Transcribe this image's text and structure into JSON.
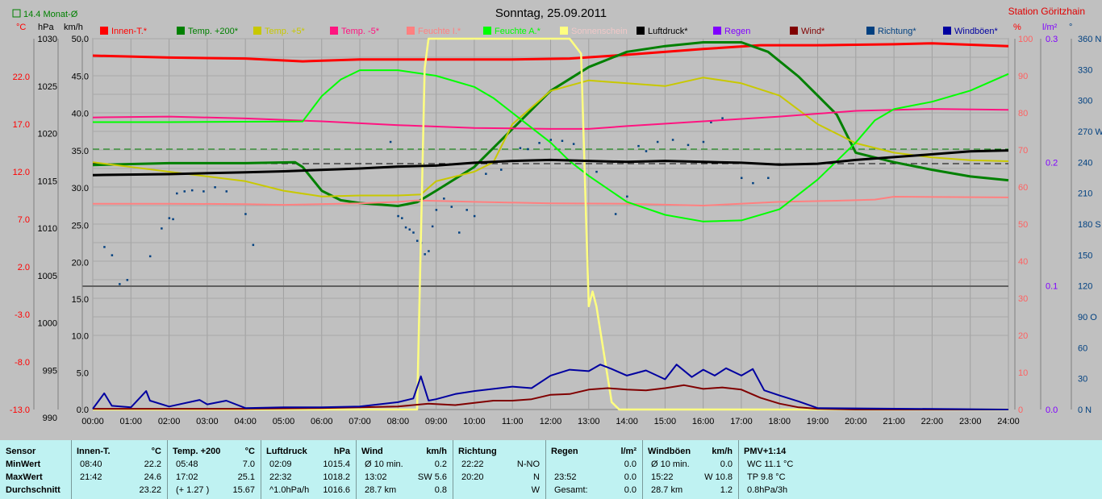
{
  "title": "Sonntag, 25.09.2011",
  "station": "Station Göritzhain",
  "monat_label": "14.4 Monat-Ø",
  "axis_units": {
    "celsius": "°C",
    "hpa": "hPa",
    "kmh": "km/h",
    "percent": "%",
    "lm2": "l/m²",
    "deg": "°"
  },
  "legend": [
    {
      "label": "Innen-T.*",
      "color": "#ff0000"
    },
    {
      "label": "Temp. +200*",
      "color": "#008000"
    },
    {
      "label": "Temp. +5*",
      "color": "#c8c800"
    },
    {
      "label": "Temp. -5*",
      "color": "#ff1480"
    },
    {
      "label": "Feuchte I.*",
      "color": "#ff8080"
    },
    {
      "label": "Feuchte A.*",
      "color": "#00ff00"
    },
    {
      "label": "Sonnenschein",
      "color": "#ffff80"
    },
    {
      "label": "Luftdruck*",
      "color": "#000000"
    },
    {
      "label": "Regen",
      "color": "#8000ff"
    },
    {
      "label": "Wind*",
      "color": "#800000"
    },
    {
      "label": "Richtung*",
      "color": "#004080"
    },
    {
      "label": "Windböen*",
      "color": "#0000a0"
    }
  ],
  "axes": {
    "celsius": [
      "22.0",
      "17.0",
      "12.0",
      "7.0",
      "2.0",
      "-3.0",
      "-8.0",
      "-13.0"
    ],
    "hpa": [
      "1030",
      "1025",
      "1020",
      "1015",
      "1010",
      "1005",
      "1000",
      "995",
      "990"
    ],
    "kmh_upper": [
      "50.0",
      "45.0",
      "40.0",
      "35.0",
      "30.0",
      "25.0",
      "20.0"
    ],
    "kmh_lower": [
      "15.0",
      "10.0",
      "5.0",
      "0.0"
    ],
    "percent_upper": [
      "100",
      "90",
      "80",
      "70",
      "60",
      "50",
      "40"
    ],
    "percent_lower": [
      "30",
      "20",
      "10",
      "0"
    ],
    "lm2": [
      "0.3",
      "0.2",
      "0.1",
      "0.0"
    ],
    "deg": [
      "360 N",
      "330",
      "300",
      "270 W",
      "240",
      "210",
      "180 S",
      "150",
      "120",
      "90 O",
      "60",
      "30",
      "0 N"
    ],
    "time": [
      "00:00",
      "01:00",
      "02:00",
      "03:00",
      "04:00",
      "05:00",
      "06:00",
      "07:00",
      "08:00",
      "09:00",
      "10:00",
      "11:00",
      "12:00",
      "13:00",
      "14:00",
      "15:00",
      "16:00",
      "17:00",
      "18:00",
      "19:00",
      "20:00",
      "21:00",
      "22:00",
      "23:00",
      "24:00"
    ]
  },
  "chart_data": {
    "type": "line",
    "title": "Sonntag, 25.09.2011",
    "x_unit": "hours",
    "xlim": [
      0,
      24
    ],
    "grid": true,
    "legend_position": "top",
    "series": [
      {
        "name": "Innen-T.*",
        "axis": "°C",
        "color": "#ff0000",
        "x": [
          0,
          2,
          4,
          5.5,
          7,
          9,
          11,
          12.5,
          14,
          16,
          17.5,
          19,
          21,
          22,
          24
        ],
        "y": [
          24.2,
          24.0,
          23.9,
          23.6,
          23.8,
          23.8,
          23.8,
          23.9,
          24.3,
          24.9,
          25.3,
          25.3,
          25.4,
          25.5,
          25.2
        ]
      },
      {
        "name": "Temp. +200*",
        "axis": "°C",
        "color": "#008000",
        "x": [
          0,
          2,
          4,
          5.3,
          5.5,
          6,
          6.5,
          7,
          8,
          8.5,
          9,
          10,
          11,
          12,
          13,
          14,
          15,
          16,
          17,
          17.7,
          18.5,
          19.5,
          20,
          21,
          22,
          23,
          24
        ],
        "y": [
          12.7,
          12.9,
          12.9,
          13.0,
          12.5,
          10.0,
          9.0,
          8.7,
          8.4,
          8.8,
          10.0,
          12.5,
          16.5,
          20.5,
          23.0,
          24.6,
          25.2,
          25.6,
          25.6,
          24.6,
          22.0,
          18.0,
          14.0,
          13.0,
          12.2,
          11.5,
          11.1
        ]
      },
      {
        "name": "Temp. +5*",
        "axis": "°C",
        "color": "#c8c800",
        "x": [
          0,
          2,
          4,
          5,
          6,
          7,
          8,
          8.6,
          9,
          10,
          10.5,
          11,
          12,
          13,
          14,
          15,
          16,
          17,
          18,
          19,
          20,
          21,
          22,
          23,
          24
        ],
        "y": [
          13.0,
          12.0,
          11.0,
          10.0,
          9.4,
          9.5,
          9.5,
          9.6,
          11.0,
          12.0,
          13.0,
          17.0,
          20.5,
          21.6,
          21.3,
          21.0,
          21.9,
          21.3,
          20.0,
          17.0,
          15.0,
          14.0,
          13.5,
          13.2,
          13.1
        ]
      },
      {
        "name": "Temp. -5*",
        "axis": "°C",
        "color": "#ff1480",
        "x": [
          0,
          2,
          4,
          6,
          8,
          10,
          12,
          13,
          14,
          16,
          18,
          20,
          22,
          24
        ],
        "y": [
          17.7,
          17.8,
          17.6,
          17.3,
          16.9,
          16.6,
          16.5,
          16.5,
          16.8,
          17.3,
          17.8,
          18.4,
          18.6,
          18.5
        ]
      },
      {
        "name": "Feuchte I.*",
        "axis": "%",
        "color": "#ff8080",
        "x": [
          0,
          2,
          4,
          5,
          7,
          8,
          8.5,
          10,
          12,
          14,
          16,
          18,
          19.5,
          20.5,
          21,
          24
        ],
        "y": [
          55.5,
          55.5,
          55.4,
          55.2,
          55.6,
          56.0,
          56.4,
          56.0,
          55.6,
          55.5,
          55.0,
          56.0,
          56.3,
          56.6,
          57.4,
          57.2
        ]
      },
      {
        "name": "Feuchte A.*",
        "axis": "%",
        "color": "#00ff00",
        "x": [
          0,
          2,
          4,
          5.5,
          6,
          6.5,
          7,
          8,
          9,
          10,
          10.5,
          11,
          11.5,
          12,
          12.5,
          13,
          14,
          15,
          16,
          17,
          18,
          19,
          20,
          20.5,
          21,
          22,
          23,
          24
        ],
        "y": [
          77.5,
          77.5,
          77.6,
          77.7,
          84.5,
          89,
          91.5,
          91.5,
          90,
          87,
          84,
          80,
          76,
          72,
          67,
          63,
          56,
          52.5,
          50.7,
          51.0,
          54,
          62,
          72,
          78,
          81,
          83,
          86,
          90.5
        ]
      },
      {
        "name": "Sonnenschein",
        "axis": "km/h",
        "color": "#ffff80",
        "x": [
          0,
          8.5,
          8.7,
          8.8,
          12.5,
          12.8,
          13.0,
          13.1,
          13.2,
          13.6,
          13.8,
          24
        ],
        "y": [
          0,
          0,
          46,
          50,
          50,
          48,
          14,
          16,
          14,
          1,
          0,
          0
        ]
      },
      {
        "name": "Luftdruck*",
        "axis": "hPa",
        "color": "#000000",
        "x": [
          0,
          2,
          4,
          5,
          7,
          8,
          9,
          10,
          11,
          12,
          13,
          14,
          15,
          16,
          17,
          18,
          19,
          20,
          21,
          22,
          23,
          24
        ],
        "y": [
          1015.6,
          1015.7,
          1015.9,
          1016.0,
          1016.3,
          1016.5,
          1016.6,
          1016.9,
          1017.1,
          1017.2,
          1017.1,
          1017.0,
          1017.1,
          1017.0,
          1016.9,
          1016.7,
          1016.8,
          1017.2,
          1017.5,
          1017.8,
          1018.1,
          1018.2
        ]
      },
      {
        "name": "Wind*",
        "axis": "km/h",
        "color": "#800000",
        "x": [
          0,
          2,
          4,
          6,
          8,
          8.8,
          9.5,
          10,
          10.5,
          11,
          11.5,
          12,
          12.5,
          13,
          13.5,
          14,
          14.5,
          15,
          15.5,
          16,
          16.5,
          17,
          17.5,
          18,
          18.5,
          19,
          20,
          24
        ],
        "y": [
          0.1,
          0.1,
          0.1,
          0.2,
          0.4,
          0.8,
          0.6,
          0.9,
          1.2,
          1.2,
          1.4,
          2.0,
          2.1,
          2.7,
          2.9,
          2.7,
          2.6,
          2.9,
          3.3,
          2.8,
          3.0,
          2.7,
          1.6,
          0.8,
          0.3,
          0.1,
          0.0,
          0.0
        ]
      },
      {
        "name": "Windböen*",
        "axis": "km/h",
        "color": "#0000a0",
        "x": [
          0,
          0.3,
          0.5,
          1,
          1.4,
          1.5,
          2,
          2.8,
          3,
          3.5,
          4,
          5,
          6,
          7,
          8,
          8.4,
          8.6,
          8.8,
          9,
          9.5,
          10,
          10.5,
          11,
          11.5,
          12,
          12.5,
          13,
          13.3,
          13.6,
          14,
          14.5,
          15,
          15.3,
          15.7,
          16,
          16.3,
          16.6,
          17,
          17.3,
          17.6,
          18,
          18.5,
          19,
          24
        ],
        "y": [
          0.1,
          2.2,
          0.5,
          0.3,
          2.5,
          1.2,
          0.4,
          1.3,
          0.7,
          1.2,
          0.2,
          0.3,
          0.3,
          0.4,
          1.0,
          1.5,
          4.5,
          1.2,
          1.4,
          2.1,
          2.5,
          2.8,
          3.1,
          2.9,
          4.6,
          5.4,
          5.2,
          6.1,
          5.5,
          4.6,
          5.3,
          4.1,
          6.1,
          4.4,
          5.4,
          4.6,
          5.6,
          4.6,
          5.5,
          2.6,
          1.9,
          1.1,
          0.2,
          0.0
        ]
      }
    ],
    "scatter": {
      "name": "Richtung*",
      "axis": "°",
      "color": "#004080",
      "x": [
        0.3,
        0.5,
        0.7,
        0.9,
        1.5,
        1.8,
        2.0,
        2.1,
        2.2,
        2.4,
        2.6,
        2.9,
        3.2,
        3.5,
        4.0,
        4.2,
        7.8,
        8.0,
        8.1,
        8.2,
        8.3,
        8.4,
        8.5,
        8.6,
        8.7,
        8.8,
        8.9,
        9.0,
        9.2,
        9.4,
        9.6,
        9.8,
        10.0,
        10.3,
        10.7,
        11.2,
        11.4,
        11.7,
        12.0,
        12.3,
        12.6,
        13.2,
        13.7,
        14.0,
        14.3,
        14.5,
        14.8,
        15.2,
        15.6,
        16.0,
        16.2,
        16.5,
        17.0,
        17.3,
        17.7
      ],
      "y": [
        158,
        150,
        122,
        126,
        149,
        176,
        186,
        185,
        210,
        212,
        213,
        212,
        216,
        212,
        190,
        160,
        260,
        188,
        186,
        177,
        175,
        172,
        164,
        162,
        151,
        154,
        178,
        194,
        205,
        197,
        172,
        194,
        188,
        229,
        233,
        254,
        253,
        259,
        262,
        261,
        258,
        231,
        190,
        207,
        256,
        251,
        260,
        262,
        257,
        260,
        279,
        283,
        225,
        220,
        225
      ]
    }
  },
  "stats": {
    "rows": [
      "Sensor",
      "MinWert",
      "MaxWert",
      "Durchschnitt"
    ],
    "columns": [
      {
        "name": "Innen-T.",
        "unit": "°C",
        "cells": [
          [
            "08:40",
            "22.2"
          ],
          [
            "21:42",
            "24.6"
          ],
          [
            "",
            "23.22"
          ]
        ]
      },
      {
        "name": "Temp. +200",
        "unit": "°C",
        "cells": [
          [
            "05:48",
            "7.0"
          ],
          [
            "17:02",
            "25.1"
          ],
          [
            "(+ 1.27 )",
            "15.67"
          ]
        ]
      },
      {
        "name": "Luftdruck",
        "unit": "hPa",
        "cells": [
          [
            "02:09",
            "1015.4"
          ],
          [
            "22:32",
            "1018.2"
          ],
          [
            "^1.0hPa/h",
            "1016.6"
          ]
        ]
      },
      {
        "name": "Wind",
        "unit": "km/h",
        "cells": [
          [
            "Ø 10 min.",
            "0.2"
          ],
          [
            "13:02",
            "SW 5.6"
          ],
          [
            "28.7 km",
            "0.8"
          ]
        ]
      },
      {
        "name": "Richtung",
        "unit": "",
        "cells": [
          [
            "22:22",
            "N-NO"
          ],
          [
            "20:20",
            "N"
          ],
          [
            "",
            "W"
          ]
        ]
      },
      {
        "name": "Regen",
        "unit": "l/m²",
        "cells": [
          [
            "",
            "0.0"
          ],
          [
            "23:52",
            "0.0"
          ],
          [
            "Gesamt:",
            "0.0"
          ]
        ]
      },
      {
        "name": "Windböen",
        "unit": "km/h",
        "cells": [
          [
            "Ø 10 min.",
            "0.0"
          ],
          [
            "15:22",
            "W 10.8"
          ],
          [
            "28.7 km",
            "1.2"
          ]
        ]
      },
      {
        "name": "PMV+1:14",
        "unit": "",
        "cells": [
          [
            "WC 11.1 °C",
            ""
          ],
          [
            "TP 9.8 °C",
            ""
          ],
          [
            "0.8hPa/3h",
            ""
          ]
        ]
      }
    ]
  }
}
